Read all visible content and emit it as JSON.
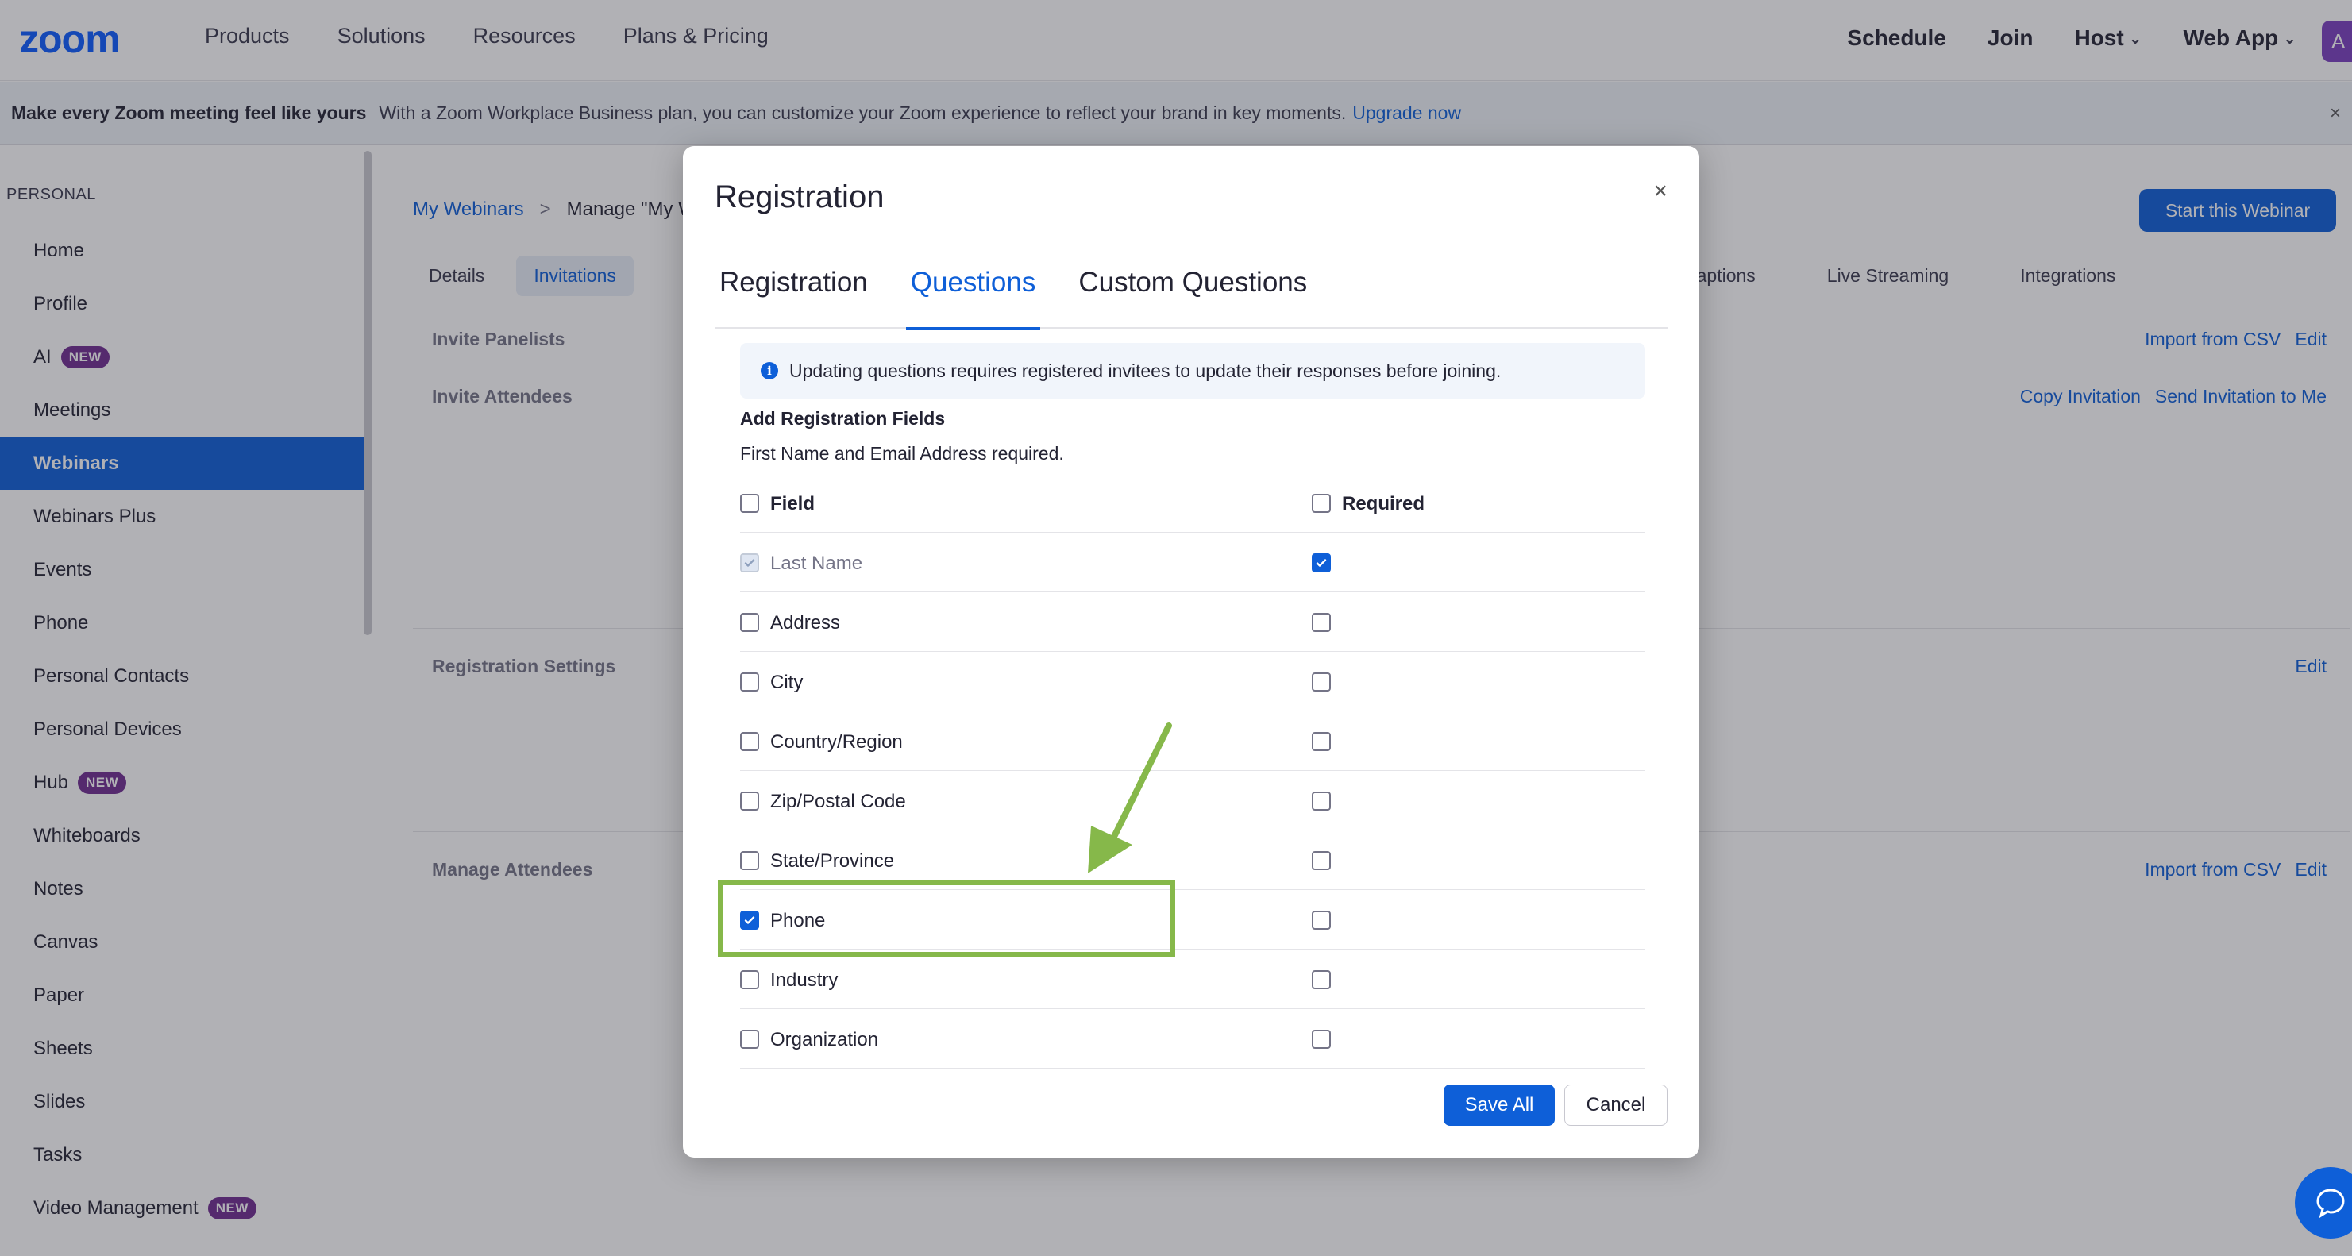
{
  "topnav": {
    "logo": "zoom",
    "left_items": [
      "Products",
      "Solutions",
      "Resources",
      "Plans & Pricing"
    ],
    "right_items": [
      {
        "label": "Schedule",
        "caret": false
      },
      {
        "label": "Join",
        "caret": false
      },
      {
        "label": "Host",
        "caret": true
      },
      {
        "label": "Web App",
        "caret": true
      }
    ],
    "avatar_letter": "A"
  },
  "banner": {
    "headline": "Make every Zoom meeting feel like yours",
    "text": "With a Zoom Workplace Business plan, you can customize your Zoom experience to reflect your brand in key moments.",
    "link": "Upgrade now",
    "close": "×"
  },
  "sidebar": {
    "heading": "PERSONAL",
    "items": [
      {
        "label": "Home",
        "badge": ""
      },
      {
        "label": "Profile",
        "badge": ""
      },
      {
        "label": "AI",
        "badge": "NEW"
      },
      {
        "label": "Meetings",
        "badge": ""
      },
      {
        "label": "Webinars",
        "badge": "",
        "active": true
      },
      {
        "label": "Webinars Plus",
        "badge": ""
      },
      {
        "label": "Events",
        "badge": ""
      },
      {
        "label": "Phone",
        "badge": ""
      },
      {
        "label": "Personal Contacts",
        "badge": ""
      },
      {
        "label": "Personal Devices",
        "badge": ""
      },
      {
        "label": "Hub",
        "badge": "NEW"
      },
      {
        "label": "Whiteboards",
        "badge": ""
      },
      {
        "label": "Notes",
        "badge": ""
      },
      {
        "label": "Canvas",
        "badge": ""
      },
      {
        "label": "Paper",
        "badge": ""
      },
      {
        "label": "Sheets",
        "badge": ""
      },
      {
        "label": "Slides",
        "badge": ""
      },
      {
        "label": "Tasks",
        "badge": ""
      },
      {
        "label": "Video Management",
        "badge": "NEW"
      }
    ]
  },
  "main": {
    "breadcrumb": {
      "link": "My Webinars",
      "separator": ">",
      "current": "Manage \"My W"
    },
    "start_button": "Start this Webinar",
    "tabs": [
      "Details",
      "Invitations"
    ],
    "tabs_right": [
      "Captions",
      "Live Streaming",
      "Integrations"
    ],
    "sections": [
      {
        "title": "Invite Panelists",
        "actions": [
          "Import from CSV",
          "Edit"
        ]
      },
      {
        "title": "Invite Attendees",
        "actions": [
          "Copy Invitation",
          "Send Invitation to Me"
        ]
      },
      {
        "title": "Registration Settings",
        "actions": [
          "Edit"
        ]
      },
      {
        "title": "Manage Attendees",
        "actions": [
          "Import from CSV",
          "Edit"
        ]
      }
    ]
  },
  "modal": {
    "title": "Registration",
    "close": "×",
    "tabs": [
      {
        "label": "Registration",
        "active": false
      },
      {
        "label": "Questions",
        "active": true
      },
      {
        "label": "Custom Questions",
        "active": false
      }
    ],
    "info_icon": "i",
    "info_text": "Updating questions requires registered invitees to update their responses before joining.",
    "section_heading": "Add Registration Fields",
    "section_sub": "First Name and Email Address required.",
    "header": {
      "field": "Field",
      "required": "Required"
    },
    "fields": [
      {
        "label": "Last Name",
        "checked": true,
        "disabled": true,
        "required": true
      },
      {
        "label": "Address",
        "checked": false,
        "required": false
      },
      {
        "label": "City",
        "checked": false,
        "required": false
      },
      {
        "label": "Country/Region",
        "checked": false,
        "required": false
      },
      {
        "label": "Zip/Postal Code",
        "checked": false,
        "required": false
      },
      {
        "label": "State/Province",
        "checked": false,
        "required": false
      },
      {
        "label": "Phone",
        "checked": true,
        "required": false
      },
      {
        "label": "Industry",
        "checked": false,
        "required": false
      },
      {
        "label": "Organization",
        "checked": false,
        "required": false
      }
    ],
    "save": "Save All",
    "cancel": "Cancel"
  },
  "colors": {
    "accent": "#0e5fd8",
    "highlight": "#86b84a",
    "badge": "#6f2c91"
  }
}
